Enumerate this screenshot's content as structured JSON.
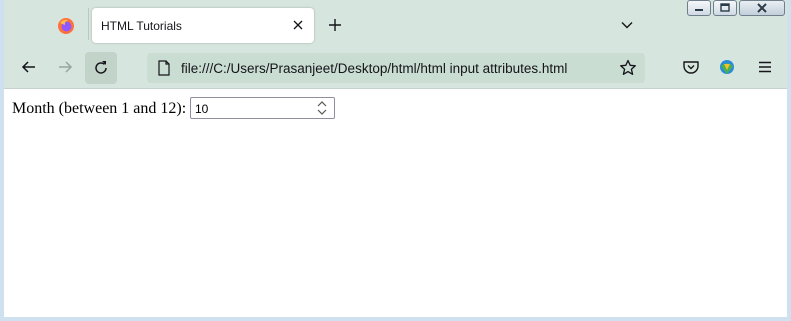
{
  "browser": {
    "tab": {
      "title": "HTML Tutorials",
      "close_icon": "close-icon"
    },
    "new_tab_icon": "plus-icon",
    "tab_list_icon": "chevron-down-icon",
    "window_controls": [
      "minimize",
      "maximize",
      "close"
    ],
    "nav": {
      "back_icon": "back-arrow-icon",
      "forward_icon": "forward-arrow-icon",
      "reload_icon": "reload-icon",
      "url": "file:///C:/Users/Prasanjeet/Desktop/html/html input attributes.html",
      "bookmark_icon": "star-icon",
      "pocket_icon": "pocket-icon",
      "extension_icon": "download-manager-icon",
      "menu_icon": "hamburger-menu-icon"
    },
    "colors": {
      "chrome": "#d6e5dd",
      "urlbar": "#c9ddd2",
      "tab_bg": "#ffffff"
    }
  },
  "page": {
    "month_label": "Month (between 1 and 12):",
    "month_value": "10"
  }
}
